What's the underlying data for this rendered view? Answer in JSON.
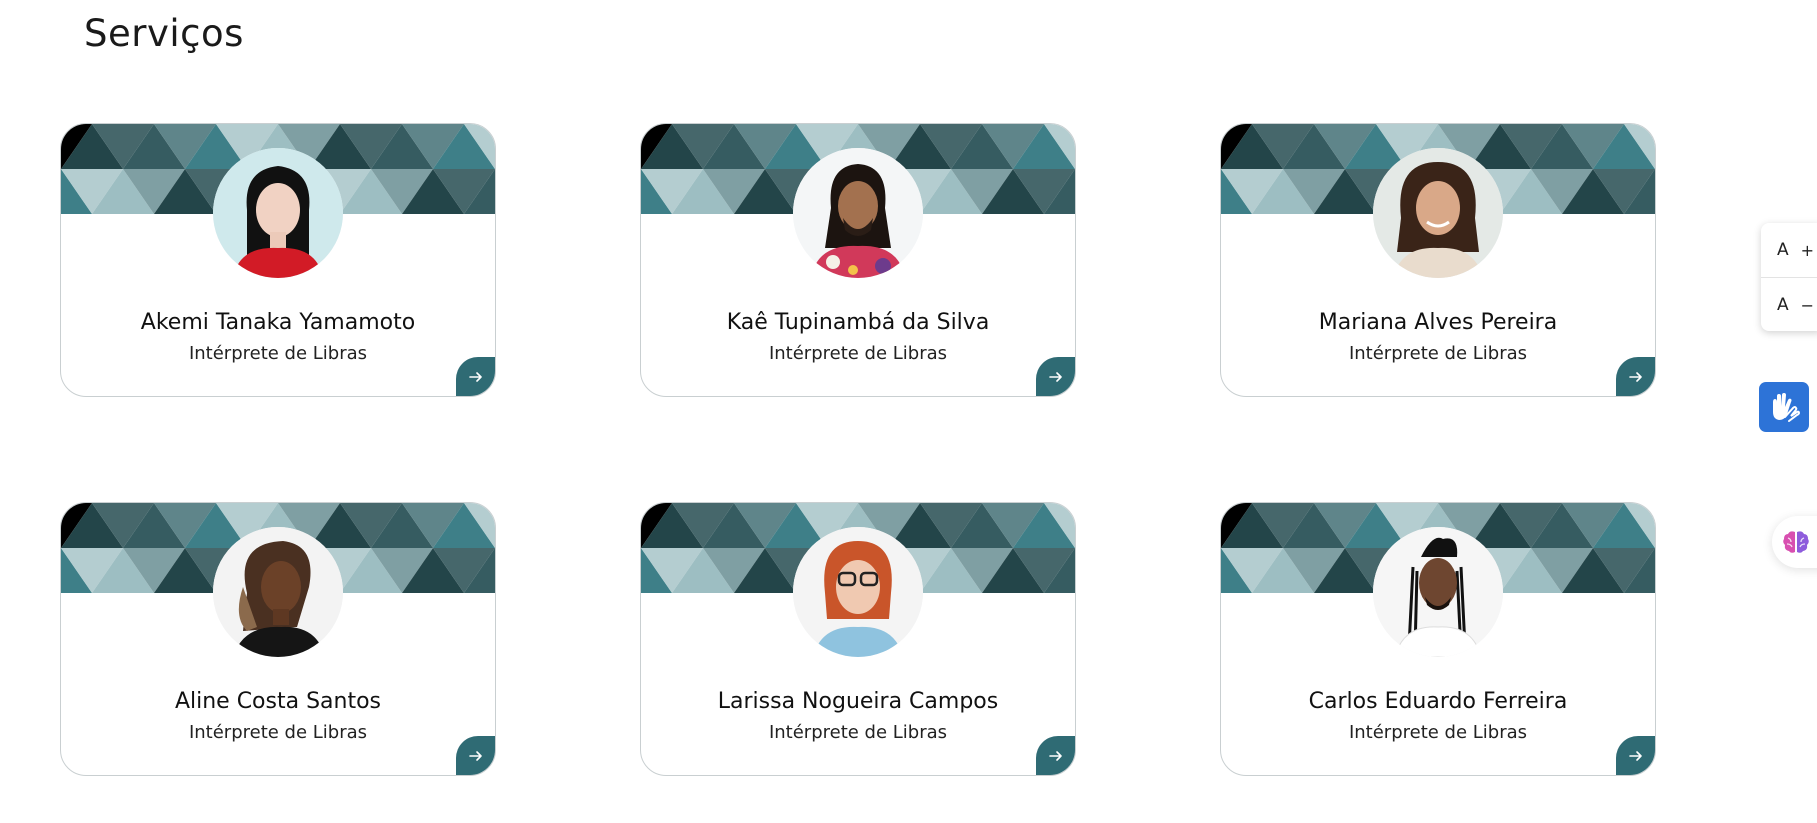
{
  "header": {
    "title": "Serviços"
  },
  "cards": [
    {
      "name": "Akemi Tanaka Yamamoto",
      "role": "Intérprete de Libras"
    },
    {
      "name": "Kaê Tupinambá da Silva",
      "role": "Intérprete de Libras"
    },
    {
      "name": "Mariana Alves Pereira",
      "role": "Intérprete de Libras"
    },
    {
      "name": "Aline Costa Santos",
      "role": "Intérprete de Libras"
    },
    {
      "name": "Larissa Nogueira Campos",
      "role": "Intérprete de Libras"
    },
    {
      "name": "Carlos Eduardo Ferreira",
      "role": "Intérprete de Libras"
    }
  ],
  "font_controls": {
    "increase_letter": "A",
    "increase_sign": "+",
    "decrease_letter": "A",
    "decrease_sign": "−"
  },
  "icons": {
    "card_action": "arrow-right-icon",
    "libras": "sign-language-hands-icon",
    "cognitive": "brain-icon"
  },
  "colors": {
    "accent": "#2f6b74",
    "libras_button": "#2d73d7",
    "banner_dark": "#234549",
    "banner_mid": "#5f858a",
    "banner_light": "#9dbec2"
  }
}
